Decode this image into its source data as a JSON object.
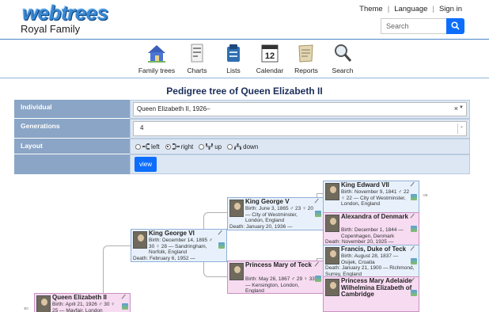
{
  "header": {
    "logo": "webtrees",
    "site_title": "Royal Family",
    "links": [
      "Theme",
      "Language",
      "Sign in"
    ],
    "search_placeholder": "Search"
  },
  "menu": [
    {
      "label": "Family trees",
      "icon": "house-icon"
    },
    {
      "label": "Charts",
      "icon": "charts-icon"
    },
    {
      "label": "Lists",
      "icon": "lists-icon"
    },
    {
      "label": "Calendar",
      "icon": "calendar-icon",
      "calendar_day": "12"
    },
    {
      "label": "Reports",
      "icon": "reports-icon"
    },
    {
      "label": "Search",
      "icon": "magnifier-icon"
    }
  ],
  "page_title": "Pedigree tree of Queen Elizabeth II",
  "form": {
    "individual_label": "Individual",
    "individual_value": "Queen Elizabeth II, 1926–",
    "generations_label": "Generations",
    "generations_value": "4",
    "layout_label": "Layout",
    "layout_options": [
      "left",
      "right",
      "up",
      "down"
    ],
    "layout_selected": "right",
    "view_button": "view"
  },
  "tree": {
    "root": {
      "name": "Queen Elizabeth II",
      "birth": "Birth: April 21, 1926 ♂ 30 ♀ 25 — Mayfair, London"
    },
    "father": {
      "name": "King George VI",
      "birth": "Birth: December 14, 1895 ♂ 30 ♀ 28 — Sandringham, Norfolk, England",
      "death": "Death: February 6, 1952 —"
    },
    "paternal_grandfather": {
      "name": "King George V",
      "birth": "Birth: June 3, 1865 ♂ 23 ♀ 20 — City of Westminster, London, England",
      "death": "Death: January 20, 1936 —"
    },
    "paternal_grandmother": {
      "name": "Princess Mary of Teck",
      "birth": "Birth: May 26, 1867 ♂ 29 ♀ 33 — Kensington, London, England"
    },
    "ggf1": {
      "name": "King Edward VII",
      "birth": "Birth: November 9, 1841 ♂ 22 ♀ 22 — City of Westminster, London, England"
    },
    "ggm1": {
      "name": "Alexandra of Denmark",
      "birth": "Birth: December 1, 1844 — Copenhagen, Denmark",
      "death": "Death: November 20, 1925 —"
    },
    "ggf2": {
      "name": "Francis, Duke of Teck",
      "birth": "Birth: August 28, 1837 — Osijek, Croatia",
      "death": "Death: January 21, 1900 — Richmond, Surrey, England"
    },
    "ggm2": {
      "name": "Princess Mary Adelaide Wilhelmina Elizabeth of Cambridge"
    }
  },
  "colors": {
    "accent": "#0d6efd",
    "form_label_bg": "#8aa5c6",
    "male_box": "#e8f1fb",
    "female_box": "#f6dbf1",
    "title": "#1a2d5a"
  }
}
